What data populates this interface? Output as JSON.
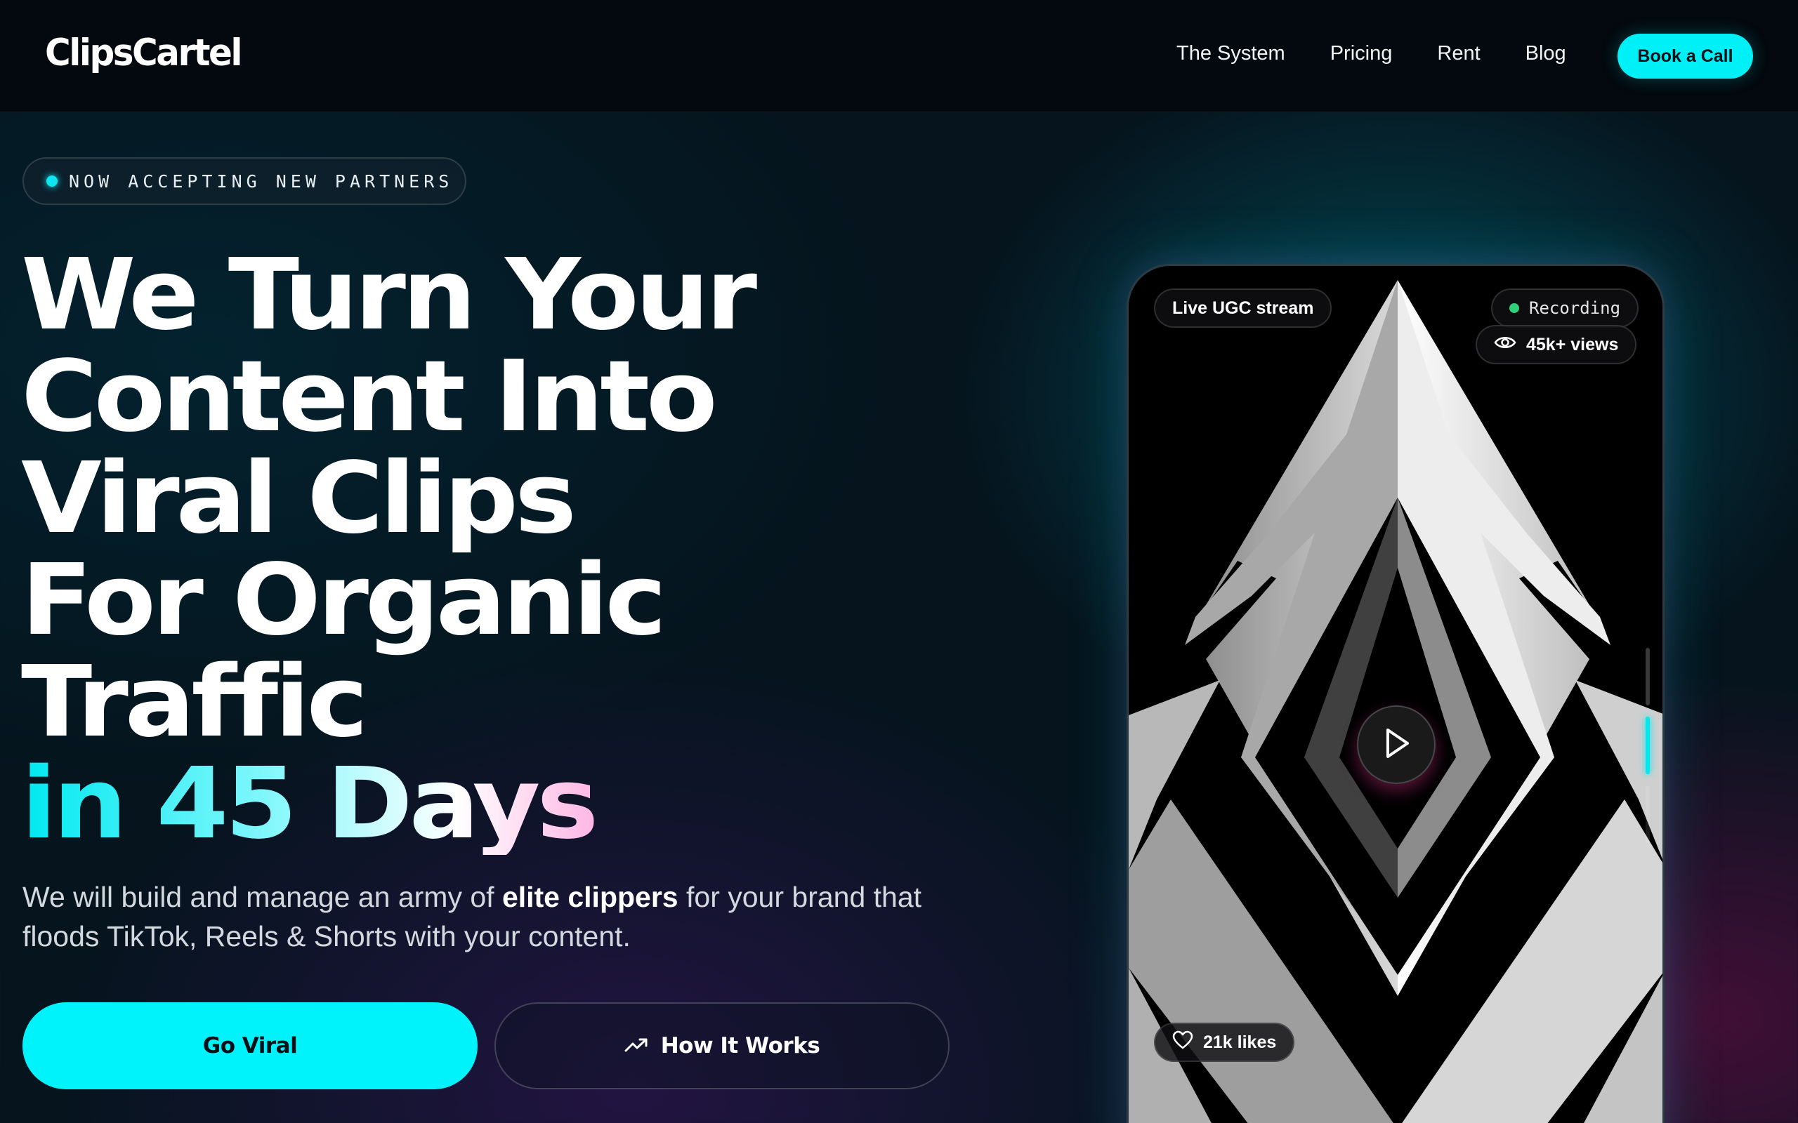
{
  "nav": {
    "logo": "ClipsCartel",
    "links": [
      "The System",
      "Pricing",
      "Rent",
      "Blog"
    ],
    "cta": "Book a Call"
  },
  "hero": {
    "badge": "NOW ACCEPTING NEW PARTNERS",
    "headline_lines": [
      "We Turn Your",
      "Content Into",
      "Viral Clips",
      "For Organic",
      "Traffic"
    ],
    "headline_highlight": "in 45 Days",
    "subtext_before": "We will build and manage an army of ",
    "subtext_bold": "elite clippers",
    "subtext_after": " for your brand that floods TikTok, Reels & Shorts with your content.",
    "primary_cta": "Go Viral",
    "secondary_cta": "How It Works"
  },
  "phone": {
    "live_label": "Live UGC stream",
    "recording_label": "Recording",
    "views_label": "45k+ views",
    "likes_label": "21k likes"
  },
  "colors": {
    "accent": "#00F2FA",
    "pink": "#E81CAE",
    "background": "#05141D"
  }
}
